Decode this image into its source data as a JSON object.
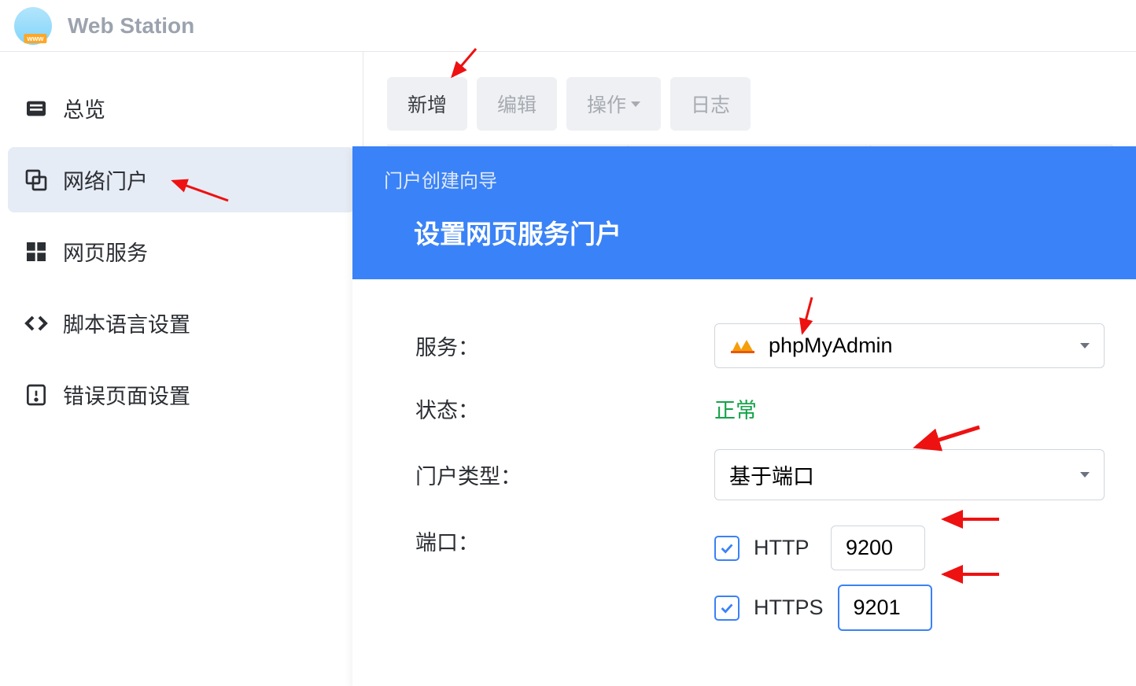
{
  "app": {
    "title": "Web Station"
  },
  "sidebar": {
    "items": [
      {
        "label": "总览"
      },
      {
        "label": "网络门户"
      },
      {
        "label": "网页服务"
      },
      {
        "label": "脚本语言设置"
      },
      {
        "label": "错误页面设置"
      }
    ]
  },
  "toolbar": {
    "add": "新增",
    "edit": "编辑",
    "action": "操作",
    "log": "日志"
  },
  "wizard": {
    "breadcrumb": "门户创建向导",
    "title": "设置网页服务门户",
    "form": {
      "service_label": "服务：",
      "service_value": "phpMyAdmin",
      "status_label": "状态：",
      "status_value": "正常",
      "type_label": "门户类型：",
      "type_value": "基于端口",
      "port_label": "端口：",
      "http": {
        "label": "HTTP",
        "value": "9200",
        "checked": true
      },
      "https": {
        "label": "HTTPS",
        "value": "9201",
        "checked": true
      }
    }
  }
}
